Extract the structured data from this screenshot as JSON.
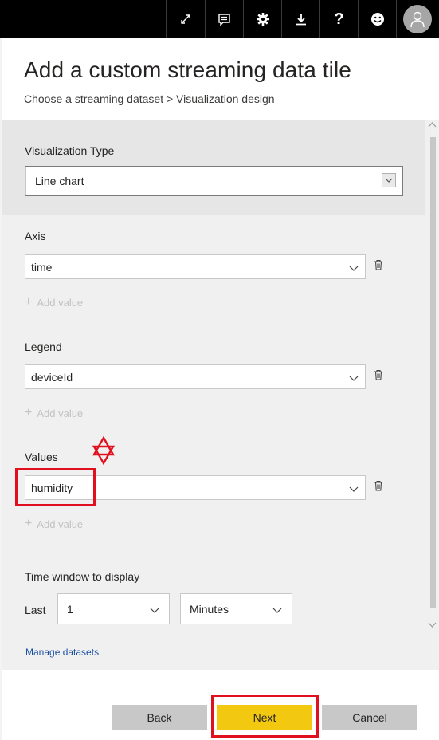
{
  "toolbar": {
    "icons": [
      "expand-icon",
      "comment-icon",
      "gear-icon",
      "download-icon",
      "help-icon",
      "smiley-icon",
      "user-avatar-icon"
    ],
    "help_glyph": "?"
  },
  "header": {
    "title": "Add a custom streaming data tile",
    "breadcrumb": "Choose a streaming dataset > Visualization design"
  },
  "visualization_type": {
    "label": "Visualization Type",
    "value": "Line chart"
  },
  "axis": {
    "label": "Axis",
    "value": "time",
    "add_value": "Add value"
  },
  "legend": {
    "label": "Legend",
    "value": "deviceId",
    "add_value": "Add value"
  },
  "values": {
    "label": "Values",
    "value": "humidity",
    "add_value": "Add value"
  },
  "time_window": {
    "label": "Time window to display",
    "prefix": "Last",
    "amount": "1",
    "unit": "Minutes"
  },
  "links": {
    "manage_datasets": "Manage datasets"
  },
  "buttons": {
    "back": "Back",
    "next": "Next",
    "cancel": "Cancel"
  },
  "colors": {
    "accent_next": "#f2c811",
    "highlight_red": "#e0101e",
    "link": "#1a4fa0"
  }
}
